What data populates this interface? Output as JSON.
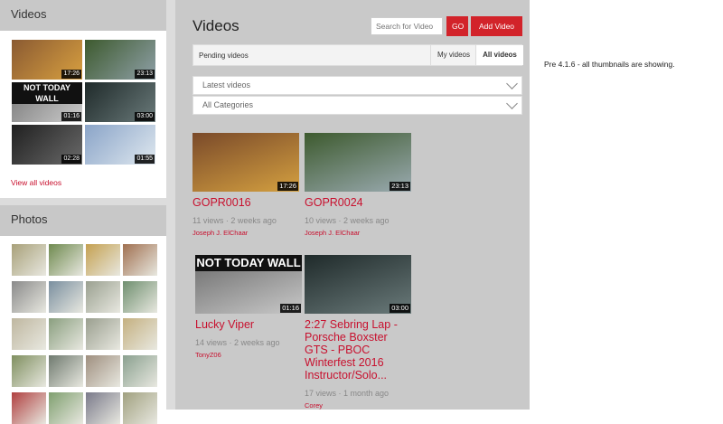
{
  "sidebar": {
    "videos": {
      "heading": "Videos",
      "thumbs": [
        {
          "duration": "17:26",
          "colors": [
            "#8a5a32",
            "#d8a040"
          ]
        },
        {
          "duration": "23:13",
          "colors": [
            "#3d5a2e",
            "#8fa0a8"
          ]
        },
        {
          "duration": "01:16",
          "label": "NOT TODAY WALL",
          "colors": [
            "#777",
            "#ccc"
          ]
        },
        {
          "duration": "03:00",
          "colors": [
            "#1f2a2a",
            "#6a7a7a"
          ]
        },
        {
          "duration": "02:28",
          "colors": [
            "#202020",
            "#6a6a6a"
          ]
        },
        {
          "duration": "01:55",
          "colors": [
            "#8aa4c8",
            "#dfe8ef"
          ]
        }
      ],
      "view_all": "View all videos"
    },
    "photos": {
      "heading": "Photos",
      "thumbs": [
        "#a8a079",
        "#6f8a4f",
        "#c4a050",
        "#a07050",
        "#8a8a8a",
        "#7a8f9f",
        "#9aa090",
        "#6f8f6f",
        "#bfb7a0",
        "#8a9f7f",
        "#9a9f8f",
        "#c4b080",
        "#7f8f5f",
        "#6f7a6f",
        "#9f8f7f",
        "#8aa08f",
        "#b04040",
        "#7f9f6f",
        "#7a7a8a",
        "#a0a07f",
        "#8f8f7a",
        "#9f7f6f",
        "#7a8a9a",
        "#a8b0a0"
      ]
    }
  },
  "main": {
    "title": "Videos",
    "search_placeholder": "Search for Video",
    "go_label": "GO",
    "add_label": "Add Video",
    "tabs": {
      "pending": "Pending videos",
      "my": "My videos",
      "all": "All videos"
    },
    "filter_sort": "Latest videos",
    "filter_category": "All Categories",
    "videos": [
      {
        "title": "GOPR0016",
        "views": "11 views",
        "when": "2 weeks ago",
        "author": "Joseph J. ElChaar",
        "duration": "17:26",
        "colors": [
          "#7a4a2a",
          "#d4a040"
        ]
      },
      {
        "title": "GOPR0024",
        "views": "10 views",
        "when": "2 weeks ago",
        "author": "Joseph J. ElChaar",
        "duration": "23:13",
        "colors": [
          "#3d5a2e",
          "#9aaab0"
        ]
      },
      {
        "title": "Lucky Viper",
        "views": "14 views",
        "when": "2 weeks ago",
        "author": "TonyZ06",
        "duration": "01:16",
        "label": "NOT TODAY WALL",
        "colors": [
          "#6a6a6a",
          "#c8c8c8"
        ]
      },
      {
        "title": "2:27 Sebring Lap - Porsche Boxster GTS - PBOC Winterfest 2016 Instructor/Solo...",
        "views": "17 views",
        "when": "1 month ago",
        "author": "Corey",
        "duration": "03:00",
        "colors": [
          "#1f2a2a",
          "#6a7a7a"
        ]
      }
    ]
  },
  "note": "Pre 4.1.6 - all thumbnails are showing."
}
